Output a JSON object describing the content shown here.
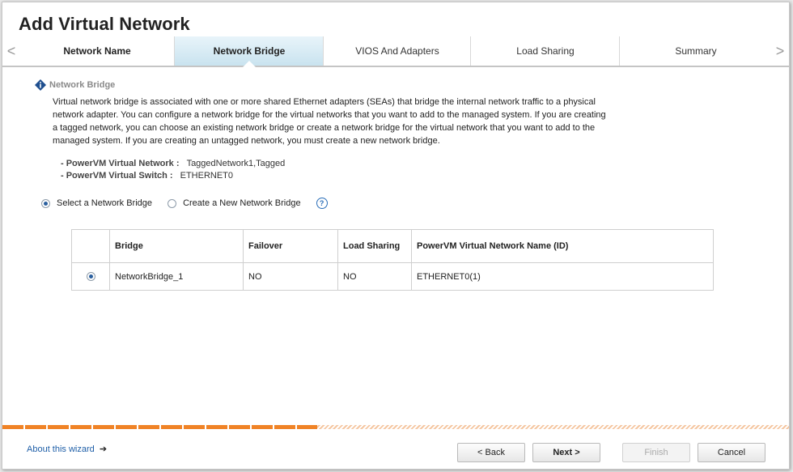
{
  "window": {
    "title": "Add Virtual Network"
  },
  "steps": [
    {
      "label": "Network Name",
      "state": "complete"
    },
    {
      "label": "Network Bridge",
      "state": "active"
    },
    {
      "label": "VIOS And Adapters",
      "state": "pending"
    },
    {
      "label": "Load Sharing",
      "state": "pending"
    },
    {
      "label": "Summary",
      "state": "pending"
    }
  ],
  "nav": {
    "left_arrow": "<",
    "right_arrow": ">"
  },
  "section": {
    "heading": "Network Bridge",
    "icon": "info-diamond-icon",
    "description": "Virtual network bridge is associated with one or more shared Ethernet adapters (SEAs) that bridge the internal network traffic to a physical network adapter. You can configure a network bridge for the virtual networks that you want to add to the managed system. If you are creating a tagged network, you can choose an existing network bridge or create a network bridge for the virtual network that you want to add to the managed system. If you are creating an untagged network, you must create a new network bridge."
  },
  "properties": [
    {
      "label": "- PowerVM Virtual Network :",
      "value": "TaggedNetwork1,Tagged"
    },
    {
      "label": "- PowerVM Virtual Switch :",
      "value": "ETHERNET0"
    }
  ],
  "options": {
    "select_label": "Select a Network Bridge",
    "create_label": "Create a New Network Bridge",
    "selected": "select",
    "help_glyph": "?"
  },
  "table": {
    "columns": [
      "",
      "Bridge",
      "Failover",
      "Load Sharing",
      "PowerVM Virtual Network Name (ID)"
    ],
    "rows": [
      {
        "selected": true,
        "bridge": "NetworkBridge_1",
        "failover": "NO",
        "load_sharing": "NO",
        "network": "ETHERNET0(1)"
      }
    ]
  },
  "progress": {
    "fraction": 0.4,
    "color": "#f08326"
  },
  "footer": {
    "about": "About this wizard",
    "about_arrow": "➔",
    "back": "< Back",
    "next": "Next >",
    "finish": "Finish",
    "cancel": "Cancel"
  }
}
